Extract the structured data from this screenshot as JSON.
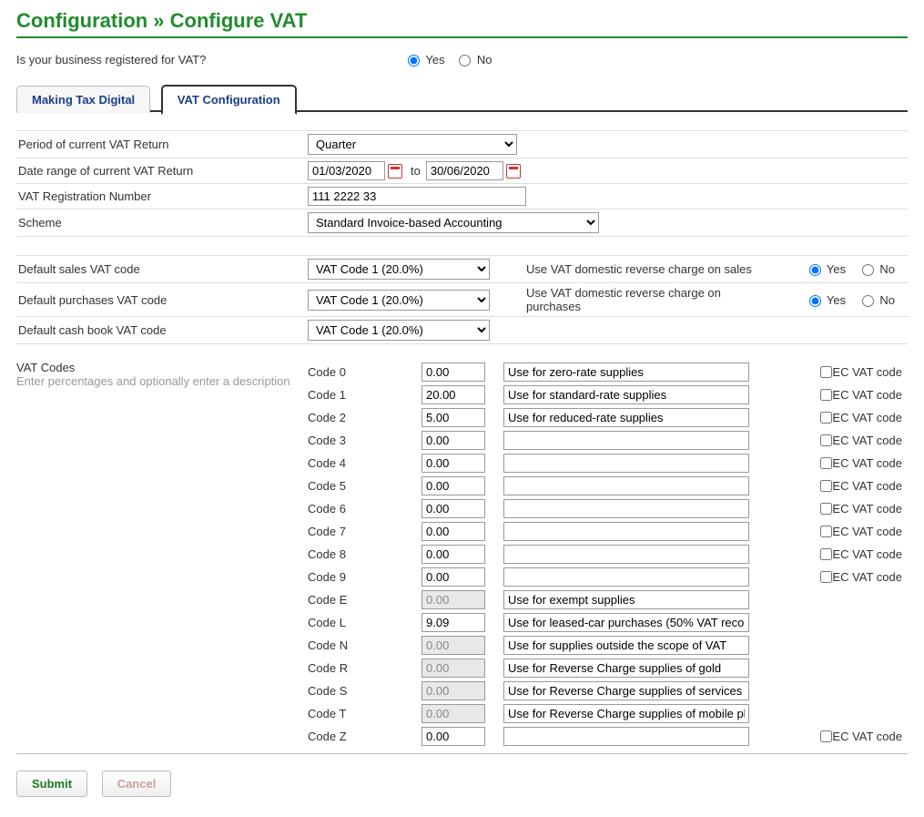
{
  "title": "Configuration » Configure VAT",
  "registration_question": "Is your business registered for VAT?",
  "yes": "Yes",
  "no": "No",
  "registered_value": "yes",
  "tabs": {
    "mtd": "Making Tax Digital",
    "vatconf": "VAT Configuration"
  },
  "labels": {
    "period": "Period of current VAT Return",
    "daterange": "Date range of current VAT Return",
    "vatreg": "VAT Registration Number",
    "scheme": "Scheme",
    "default_sales": "Default sales VAT code",
    "default_purchases": "Default purchases VAT code",
    "default_cashbook": "Default cash book VAT code",
    "reverse_sales": "Use VAT domestic reverse charge on sales",
    "reverse_purchases": "Use VAT domestic reverse charge on purchases",
    "vat_codes": "VAT Codes",
    "vat_codes_sub": "Enter percentages and optionally enter a description",
    "to": "to",
    "ec": "EC VAT code"
  },
  "values": {
    "period": "Quarter",
    "date_from": "01/03/2020",
    "date_to": "30/06/2020",
    "vatreg": "111 2222 33",
    "scheme": "Standard Invoice-based Accounting",
    "default_code": "VAT Code 1 (20.0%)",
    "reverse_sales": "yes",
    "reverse_purchases": "yes"
  },
  "codes": [
    {
      "label": "Code 0",
      "pct": "0.00",
      "desc": "Use for zero-rate supplies",
      "ec": true,
      "disabled": false
    },
    {
      "label": "Code 1",
      "pct": "20.00",
      "desc": "Use for standard-rate supplies",
      "ec": true,
      "disabled": false
    },
    {
      "label": "Code 2",
      "pct": "5.00",
      "desc": "Use for reduced-rate supplies",
      "ec": true,
      "disabled": false
    },
    {
      "label": "Code 3",
      "pct": "0.00",
      "desc": "",
      "ec": true,
      "disabled": false
    },
    {
      "label": "Code 4",
      "pct": "0.00",
      "desc": "",
      "ec": true,
      "disabled": false
    },
    {
      "label": "Code 5",
      "pct": "0.00",
      "desc": "",
      "ec": true,
      "disabled": false
    },
    {
      "label": "Code 6",
      "pct": "0.00",
      "desc": "",
      "ec": true,
      "disabled": false
    },
    {
      "label": "Code 7",
      "pct": "0.00",
      "desc": "",
      "ec": true,
      "disabled": false
    },
    {
      "label": "Code 8",
      "pct": "0.00",
      "desc": "",
      "ec": true,
      "disabled": false
    },
    {
      "label": "Code 9",
      "pct": "0.00",
      "desc": "",
      "ec": true,
      "disabled": false
    },
    {
      "label": "Code E",
      "pct": "0.00",
      "desc": "Use for exempt supplies",
      "ec": false,
      "disabled": true
    },
    {
      "label": "Code L",
      "pct": "9.09",
      "desc": "Use for leased-car purchases (50% VAT reco",
      "ec": false,
      "disabled": false
    },
    {
      "label": "Code N",
      "pct": "0.00",
      "desc": "Use for supplies outside the scope of VAT",
      "ec": false,
      "disabled": true
    },
    {
      "label": "Code R",
      "pct": "0.00",
      "desc": "Use for Reverse Charge supplies of gold",
      "ec": false,
      "disabled": true
    },
    {
      "label": "Code S",
      "pct": "0.00",
      "desc": "Use for Reverse Charge supplies of services",
      "ec": false,
      "disabled": true
    },
    {
      "label": "Code T",
      "pct": "0.00",
      "desc": "Use for Reverse Charge supplies of mobile ph",
      "ec": false,
      "disabled": true
    },
    {
      "label": "Code Z",
      "pct": "0.00",
      "desc": "",
      "ec": true,
      "disabled": false
    }
  ],
  "buttons": {
    "submit": "Submit",
    "cancel": "Cancel"
  }
}
